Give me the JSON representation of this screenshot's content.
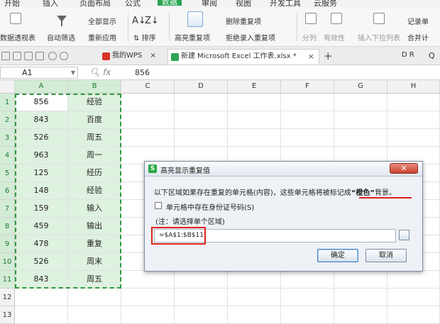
{
  "menu": {
    "items": [
      "开始",
      "插入",
      "页面布局",
      "公式",
      "数据",
      "审阅",
      "视图",
      "开发工具",
      "云服务"
    ],
    "active_index": 4
  },
  "ribbon": {
    "pivot": "数据透视表",
    "autofilter": "自动筛选",
    "show_all": "全部显示",
    "reapply": "重新应用",
    "sort_label": "排序",
    "highlight_dup": "高亮重复项",
    "delete_dup": "删除重复项",
    "reject_dup": "拒绝录入重复项",
    "split": "分列",
    "validity": "有效性",
    "insert_dropdown": "插入下拉列表",
    "record_form": "记录单",
    "merge_calc": "合并计"
  },
  "tabs": {
    "wps": "我的WPS",
    "workbook": "新建 Microsoft Excel 工作表.xlsx *",
    "plus": "+"
  },
  "formula_bar": {
    "name_box": "A1",
    "fx": "fx",
    "value": "856"
  },
  "grid": {
    "columns": [
      "A",
      "B",
      "C",
      "D",
      "E",
      "F",
      "G",
      "H"
    ],
    "rows": [
      {
        "num": "1",
        "a": "856",
        "b": "经验"
      },
      {
        "num": "2",
        "a": "843",
        "b": "百度"
      },
      {
        "num": "3",
        "a": "526",
        "b": "周五"
      },
      {
        "num": "4",
        "a": "963",
        "b": "周一"
      },
      {
        "num": "5",
        "a": "125",
        "b": "经历"
      },
      {
        "num": "6",
        "a": "148",
        "b": "经验"
      },
      {
        "num": "7",
        "a": "159",
        "b": "输入"
      },
      {
        "num": "8",
        "a": "459",
        "b": "输出"
      },
      {
        "num": "9",
        "a": "478",
        "b": "重复"
      },
      {
        "num": "10",
        "a": "526",
        "b": "周末"
      },
      {
        "num": "11",
        "a": "843",
        "b": "周五"
      },
      {
        "num": "12",
        "a": "",
        "b": ""
      },
      {
        "num": "13",
        "a": "",
        "b": ""
      }
    ]
  },
  "dialog": {
    "logo": "S",
    "title": "高亮显示重复值",
    "close": "✕",
    "msg_prefix": "以下区域如果存在重复的单元格(内容)，这些单元格将被标记成",
    "msg_color": "“橙色”",
    "msg_suffix": "背景。",
    "checkbox_label": "单元格中存在身份证号码(S)",
    "note": "(注：请选择单个区域)",
    "range_value": "=$A$1:$B$11",
    "ok": "确定",
    "cancel": "取消"
  },
  "colors": {
    "accent_green": "#2aa551",
    "selection_fill": "#dff1df",
    "marquee": "#2c9a3e",
    "annotation_red": "#e02020"
  }
}
